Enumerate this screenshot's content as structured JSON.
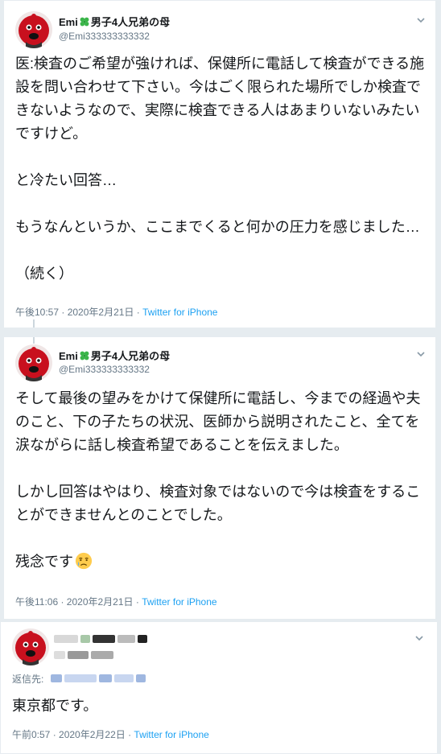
{
  "tweets": [
    {
      "author": {
        "name_prefix": "Emi",
        "name_suffix": "男子4人兄弟の母",
        "handle": "@Emi333333333332"
      },
      "body": "医:検査のご希望が強ければ、保健所に電話して検査ができる施設を問い合わせて下さい。今はごく限られた場所でしか検査できないようなので、実際に検査できる人はあまりいないみたいですけど。\n\nと冷たい回答…\n\nもうなんというか、ここまでくると何かの圧力を感じました…\n\n（続く）",
      "time": "午後10:57 · 2020年2月21日",
      "separator": " · ",
      "source": "Twitter for iPhone"
    },
    {
      "author": {
        "name_prefix": "Emi",
        "name_suffix": "男子4人兄弟の母",
        "handle": "@Emi333333333332"
      },
      "body": "そして最後の望みをかけて保健所に電話し、今までの経過や夫のこと、下の子たちの状況、医師から説明されたこと、全てを涙ながらに話し検査希望であることを伝えました。\n\nしかし回答はやはり、検査対象ではないので今は検査をすることができませんとのことでした。\n\n残念です",
      "time": "午後11:06 · 2020年2月21日",
      "separator": " · ",
      "source": "Twitter for iPhone"
    },
    {
      "reply_prefix": "返信先:",
      "body": "東京都です。",
      "time": "午前0:57 · 2020年2月22日",
      "separator": " · ",
      "source": "Twitter for iPhone"
    }
  ],
  "colors": {
    "link": "#1da1f2",
    "muted": "#657786",
    "text": "#14171a",
    "background": "#e6ecf0"
  },
  "icons": [
    "clover-emoji",
    "crying-face-emoji",
    "chevron-down-icon"
  ]
}
